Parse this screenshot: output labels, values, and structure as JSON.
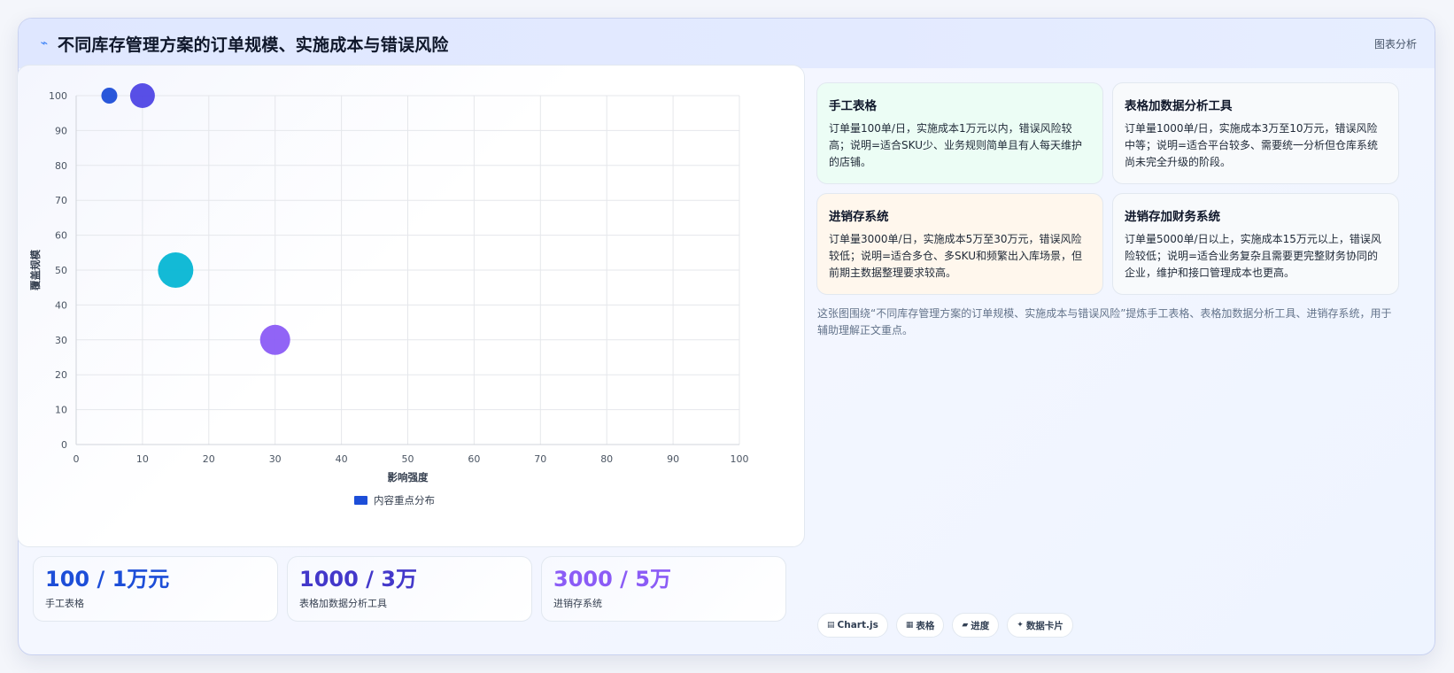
{
  "header": {
    "icon": "bolt-icon",
    "title": "不同库存管理方案的订单规模、实施成本与错误风险",
    "tag": "图表分析"
  },
  "chart_data": {
    "type": "bubble",
    "xlabel": "影响强度",
    "ylabel": "覆盖规模",
    "xlim": [
      0,
      100
    ],
    "ylim": [
      0,
      100
    ],
    "x_ticks": [
      0,
      10,
      20,
      30,
      40,
      50,
      60,
      70,
      80,
      90,
      100
    ],
    "y_ticks": [
      0,
      10,
      20,
      30,
      40,
      50,
      60,
      70,
      80,
      90,
      100
    ],
    "grid": true,
    "legend": {
      "position": "bottom",
      "label": "内容重点分布",
      "color": "#1d4ed8"
    },
    "points": [
      {
        "x": 5,
        "y": 100,
        "r": 9,
        "color": "#1d4ed8"
      },
      {
        "x": 10,
        "y": 100,
        "r": 14,
        "color": "#4f46e5"
      },
      {
        "x": 15,
        "y": 50,
        "r": 20,
        "color": "#06b6d4"
      },
      {
        "x": 30,
        "y": 30,
        "r": 17,
        "color": "#8b5cf6"
      }
    ]
  },
  "kpis": [
    {
      "value": "100 / 1万元",
      "label": "手工表格",
      "color": "#1d4ed8"
    },
    {
      "value": "1000 / 3万",
      "label": "表格加数据分析工具",
      "color": "#4338ca"
    },
    {
      "value": "3000 / 5万",
      "label": "进销存系统",
      "color": "#8b5cf6"
    }
  ],
  "info_cards": [
    {
      "title": "手工表格",
      "text": "订单量100单/日，实施成本1万元以内，错误风险较高；说明=适合SKU少、业务规则简单且有人每天维护的店铺。",
      "bg": "#ecfdf5"
    },
    {
      "title": "表格加数据分析工具",
      "text": "订单量1000单/日，实施成本3万至10万元，错误风险中等；说明=适合平台较多、需要统一分析但仓库系统尚未完全升级的阶段。",
      "bg": "#f8fafc"
    },
    {
      "title": "进销存系统",
      "text": "订单量3000单/日，实施成本5万至30万元，错误风险较低；说明=适合多仓、多SKU和频繁出入库场景，但前期主数据整理要求较高。",
      "bg": "#fff7ed"
    },
    {
      "title": "进销存加财务系统",
      "text": "订单量5000单/日以上，实施成本15万元以上，错误风险较低；说明=适合业务复杂且需要更完整财务协同的企业，维护和接口管理成本也更高。",
      "bg": "#f8fafc"
    }
  ],
  "caption": "这张图围绕“不同库存管理方案的订单规模、实施成本与错误风险”提炼手工表格、表格加数据分析工具、进销存系统，用于辅助理解正文重点。",
  "chips": [
    {
      "icon": "chart-icon",
      "glyph": "▤",
      "label": "Chart.js"
    },
    {
      "icon": "table-icon",
      "glyph": "▦",
      "label": "表格"
    },
    {
      "icon": "progress-icon",
      "glyph": "▰",
      "label": "进度"
    },
    {
      "icon": "sparkle-icon",
      "glyph": "✦",
      "label": "数据卡片"
    }
  ]
}
